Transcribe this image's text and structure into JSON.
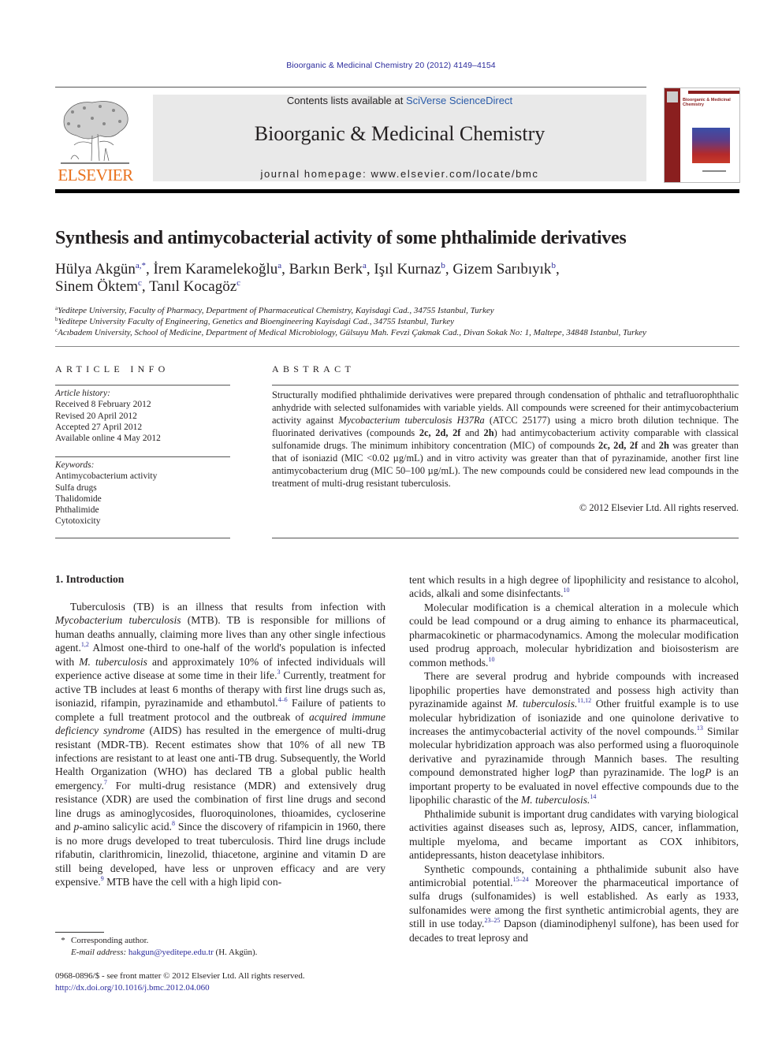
{
  "header": {
    "citation": "Bioorganic & Medicinal Chemistry 20 (2012) 4149–4154",
    "contents_prefix": "Contents lists available at ",
    "contents_link": "SciVerse ScienceDirect",
    "journal_title": "Bioorganic & Medicinal Chemistry",
    "homepage": "journal homepage: www.elsevier.com/locate/bmc",
    "publisher_logo": "ELSEVIER",
    "cover_title": "Bioorganic & Medicinal Chemistry",
    "accent_color": "#e9711c",
    "link_color": "#2b2b9c"
  },
  "article": {
    "title": "Synthesis and antimycobacterial activity of some phthalimide derivatives",
    "authors": [
      {
        "name": "Hülya Akgün",
        "sup": "a,*",
        "sep": ", "
      },
      {
        "name": "İrem Karamelekoğlu",
        "sup": "a",
        "sep": ", "
      },
      {
        "name": "Barkın Berk",
        "sup": "a",
        "sep": ", "
      },
      {
        "name": "Işıl Kurnaz",
        "sup": "b",
        "sep": ", "
      },
      {
        "name": "Gizem Sarıbıyık",
        "sup": "b",
        "sep": ","
      },
      {
        "name": "Sinem Öktem",
        "sup": "c",
        "sep": ", "
      },
      {
        "name": "Tanıl Kocagöz",
        "sup": "c",
        "sep": ""
      }
    ],
    "affiliations": [
      {
        "mark": "a",
        "text": "Yeditepe University, Faculty of Pharmacy, Department of Pharmaceutical Chemistry, Kayisdagi Cad., 34755 Istanbul, Turkey"
      },
      {
        "mark": "b",
        "text": "Yeditepe University Faculty of Engineering, Genetics and Bioengineering Kayisdagi Cad., 34755 Istanbul, Turkey"
      },
      {
        "mark": "c",
        "text": "Acıbadem University, School of Medicine, Department of Medical Microbiology, Gülsuyu Mah. Fevzi Çakmak Cad., Divan Sokak No: 1, Maltepe, 34848 Istanbul, Turkey"
      }
    ]
  },
  "article_info": {
    "heading": "ARTICLE INFO",
    "history_label": "Article history:",
    "history": [
      "Received 8 February 2012",
      "Revised 20 April 2012",
      "Accepted 27 April 2012",
      "Available online 4 May 2012"
    ],
    "keywords_label": "Keywords:",
    "keywords": [
      "Antimycobacterium activity",
      "Sulfa drugs",
      "Thalidomide",
      "Phthalimide",
      "Cytotoxicity"
    ]
  },
  "abstract": {
    "heading": "ABSTRACT",
    "p1": "Structurally modified phthalimide derivatives were prepared through condensation of phthalic and tetrafluorophthalic anhydride with selected sulfonamides with variable yields. All compounds were screened for their antimycobacterium activity against ",
    "organism": "Mycobacterium tuberculosis H37Ra",
    "p2": " (ATCC 25177) using a micro broth dilution technique. The fluorinated derivatives (compounds ",
    "compounds": "2c, 2d, 2f",
    "and": " and ",
    "compound_h": "2h",
    "p3": ") had antimycobacterium activity comparable with classical sulfonamide drugs. The minimum inhibitory concentration (MIC) of compounds ",
    "p4": " was greater than that of isoniazid (MIC <0.02 µg/mL) and in vitro activity was greater than that of pyrazinamide, another first line antimycobacterium drug (MIC 50–100 µg/mL). The new compounds could be considered new lead compounds in the treatment of multi-drug resistant tuberculosis.",
    "copyright": "© 2012 Elsevier Ltd. All rights reserved."
  },
  "introduction": {
    "heading": "1. Introduction",
    "left": {
      "a": "Tuberculosis (TB) is an illness that results from infection with ",
      "a_i": "Mycobacterium tuberculosis",
      "b": " (MTB). TB is responsible for millions of human deaths annually, claiming more lives than any other single infectious agent.",
      "ref1": "1,2",
      "c": " Almost one-third to one-half of the world's population is infected with ",
      "c_i": "M. tuberculosis",
      "d": " and approximately 10% of infected individuals will experience active disease at some time in their life.",
      "ref2": "3",
      "e": " Currently, treatment for active TB includes at least 6 months of therapy with first line drugs such as, isoniazid, rifampin, pyrazinamide and ethambutol.",
      "ref3": "4–6",
      "f": " Failure of patients to complete a full treatment protocol and the outbreak of ",
      "f_i": "acquired immune deficiency syndrome",
      "g": " (AIDS) has resulted in the emergence of multi-drug resistant (MDR-TB). Recent estimates show that 10% of all new TB infections are resistant to at least one anti-TB drug. Subsequently, the World Health Organization (WHO) has declared TB a global public health emergency.",
      "ref4": "7",
      "h": " For multi-drug resistance (MDR) and extensively drug resistance (XDR) are used the combination of first line drugs and second line drugs as aminoglycosides, fluoroquinolones, thioamides, cycloserine and ",
      "h_i": "p",
      "i": "-amino salicylic acid.",
      "ref5": "8",
      "j": " Since the discovery of rifampicin in 1960, there is no more drugs developed to treat tuberculosis. Third line drugs include rifabutin, clarithromicin, linezolid, thiacetone, arginine and vitamin D are still being developed, have less or unproven efficacy and are very expensive.",
      "ref6": "9",
      "k": " MTB have the cell with a high lipid con-"
    },
    "right": {
      "p0": "tent which results in a high degree of lipophilicity and resistance to alcohol, acids, alkali and some disinfectants.",
      "p0_ref": "10",
      "p1": "Molecular modification is a chemical alteration in a molecule which could be lead compound or a drug aiming to enhance its pharmaceutical, pharmacokinetic or pharmacodynamics. Among the molecular modification used prodrug approach, molecular hybridization and bioisosterism are common methods.",
      "p1_ref": "10",
      "p2a": "There are several prodrug and hybride compounds with increased lipophilic properties have demonstrated and possess high activity than pyrazinamide against ",
      "p2a_i": "M. tuberculosis.",
      "p2_ref1": "11,12",
      "p2b": " Other fruitful example is to use molecular hybridization of isoniazide and one quinolone derivative to increases the antimycobacterial activity of the novel compounds.",
      "p2_ref2": "13",
      "p2c": " Similar molecular hybridization approach was also performed using a fluoroquinole derivative and pyrazinamide through Mannich bases. The resulting compound demonstrated higher log",
      "p2_P": "P",
      "p2d": " than pyrazinamide. The log",
      "p2e": " is an important property to be evaluated in novel effective compounds due to the lipophilic charastic of the ",
      "p2e_i": "M. tuberculosis.",
      "p2_ref3": "14",
      "p3": "Phthalimide subunit is important drug candidates with varying biological activities against diseases such as, leprosy, AIDS, cancer, inflammation, multiple myeloma, and became important as COX inhibitors, antidepressants, histon deacetylase inhibitors.",
      "p4a": "Synthetic compounds, containing a phthalimide subunit also have antimicrobial potential.",
      "p4_ref1": "15–24",
      "p4b": " Moreover the pharmaceutical importance of sulfa drugs (sulfonamides) is well established. As early as 1933, sulfonamides were among the first synthetic antimicrobial agents, they are still in use today.",
      "p4_ref2": "23–25",
      "p4c": " Dapson (diaminodiphenyl sulfone), has been used for decades to treat leprosy and"
    }
  },
  "footnotes": {
    "star": "*",
    "corresponding": "Corresponding author.",
    "email_label": "E-mail address:",
    "email": "hakgun@yeditepe.edu.tr",
    "email_suffix": " (H. Akgün).",
    "front_matter": "0968-0896/$ - see front matter © 2012 Elsevier Ltd. All rights reserved.",
    "doi": "http://dx.doi.org/10.1016/j.bmc.2012.04.060"
  }
}
